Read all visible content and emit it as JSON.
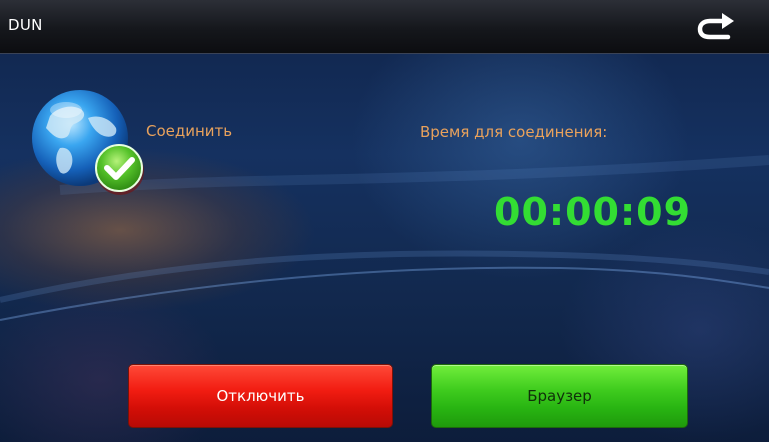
{
  "header": {
    "title": "DUN",
    "back_icon": "back-arrow-icon"
  },
  "status": {
    "icon": "globe-check-icon",
    "connect_label": "Соединить",
    "time_label": "Время для соединения:",
    "timer": "00:00:09"
  },
  "buttons": {
    "disconnect_label": "Отключить",
    "browser_label": "Браузер"
  },
  "colors": {
    "label": "#e9a25c",
    "timer": "#33dd33",
    "disconnect": "#e8170d",
    "browser": "#3cc41c"
  }
}
